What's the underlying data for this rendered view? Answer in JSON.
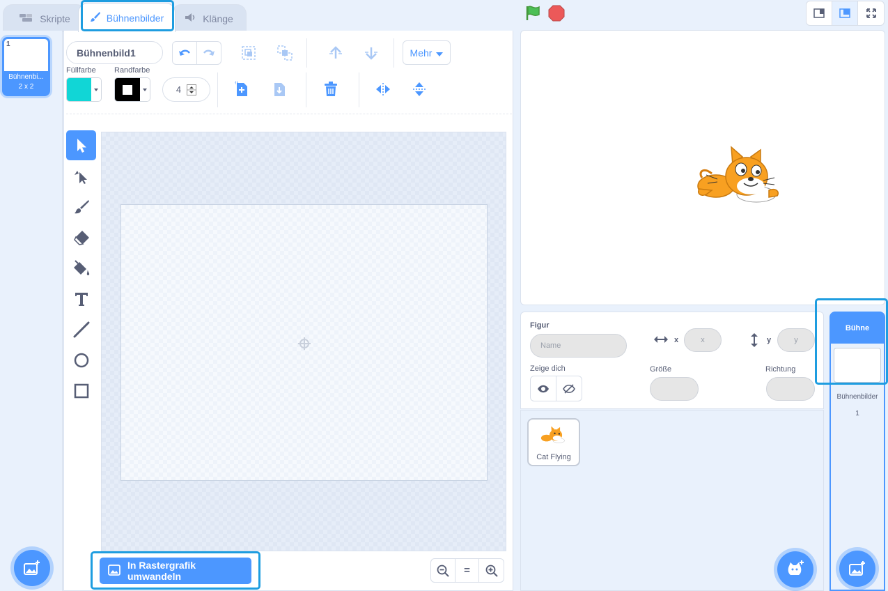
{
  "tabs": {
    "code": "Skripte",
    "backdrops": "Bühnenbilder",
    "sounds": "Klänge"
  },
  "costume_list": [
    {
      "index": "1",
      "name": "Bühnenbi...",
      "size": "2 x 2"
    }
  ],
  "editor": {
    "costume_name": "Bühnenbild1",
    "more_label": "Mehr",
    "fill_label": "Füllfarbe",
    "outline_label": "Randfarbe",
    "outline_width": "4",
    "fill_color": "#11d6d6",
    "outline_color": "#000000",
    "convert_button": "In Rastergrafik umwandeln",
    "zoom_reset": "="
  },
  "tools": [
    "select-tool",
    "reshape-tool",
    "brush-tool",
    "eraser-tool",
    "fill-tool",
    "text-tool",
    "line-tool",
    "circle-tool",
    "rectangle-tool"
  ],
  "sprite_info": {
    "sprite_label": "Figur",
    "name_placeholder": "Name",
    "x_label": "x",
    "x_placeholder": "x",
    "y_label": "y",
    "y_placeholder": "y",
    "show_label": "Zeige dich",
    "size_label": "Größe",
    "direction_label": "Richtung"
  },
  "sprites": [
    {
      "name": "Cat Flying"
    }
  ],
  "stage_panel": {
    "title": "Bühne",
    "backdrops_label": "Bühnenbilder",
    "backdrops_count": "1"
  },
  "colors": {
    "accent": "#4c97ff",
    "highlight": "#1e9de0",
    "green_flag": "#4cbf56",
    "stop": "#ec5959"
  }
}
